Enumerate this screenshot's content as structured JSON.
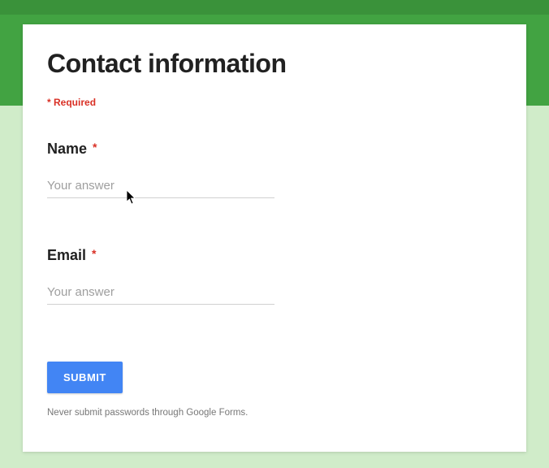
{
  "form": {
    "title": "Contact information",
    "required_label": "Required",
    "fields": [
      {
        "label": "Name",
        "required": true,
        "placeholder": "Your answer",
        "value": ""
      },
      {
        "label": "Email",
        "required": true,
        "placeholder": "Your answer",
        "value": ""
      }
    ],
    "submit_label": "SUBMIT",
    "disclaimer": "Never submit passwords through Google Forms."
  }
}
